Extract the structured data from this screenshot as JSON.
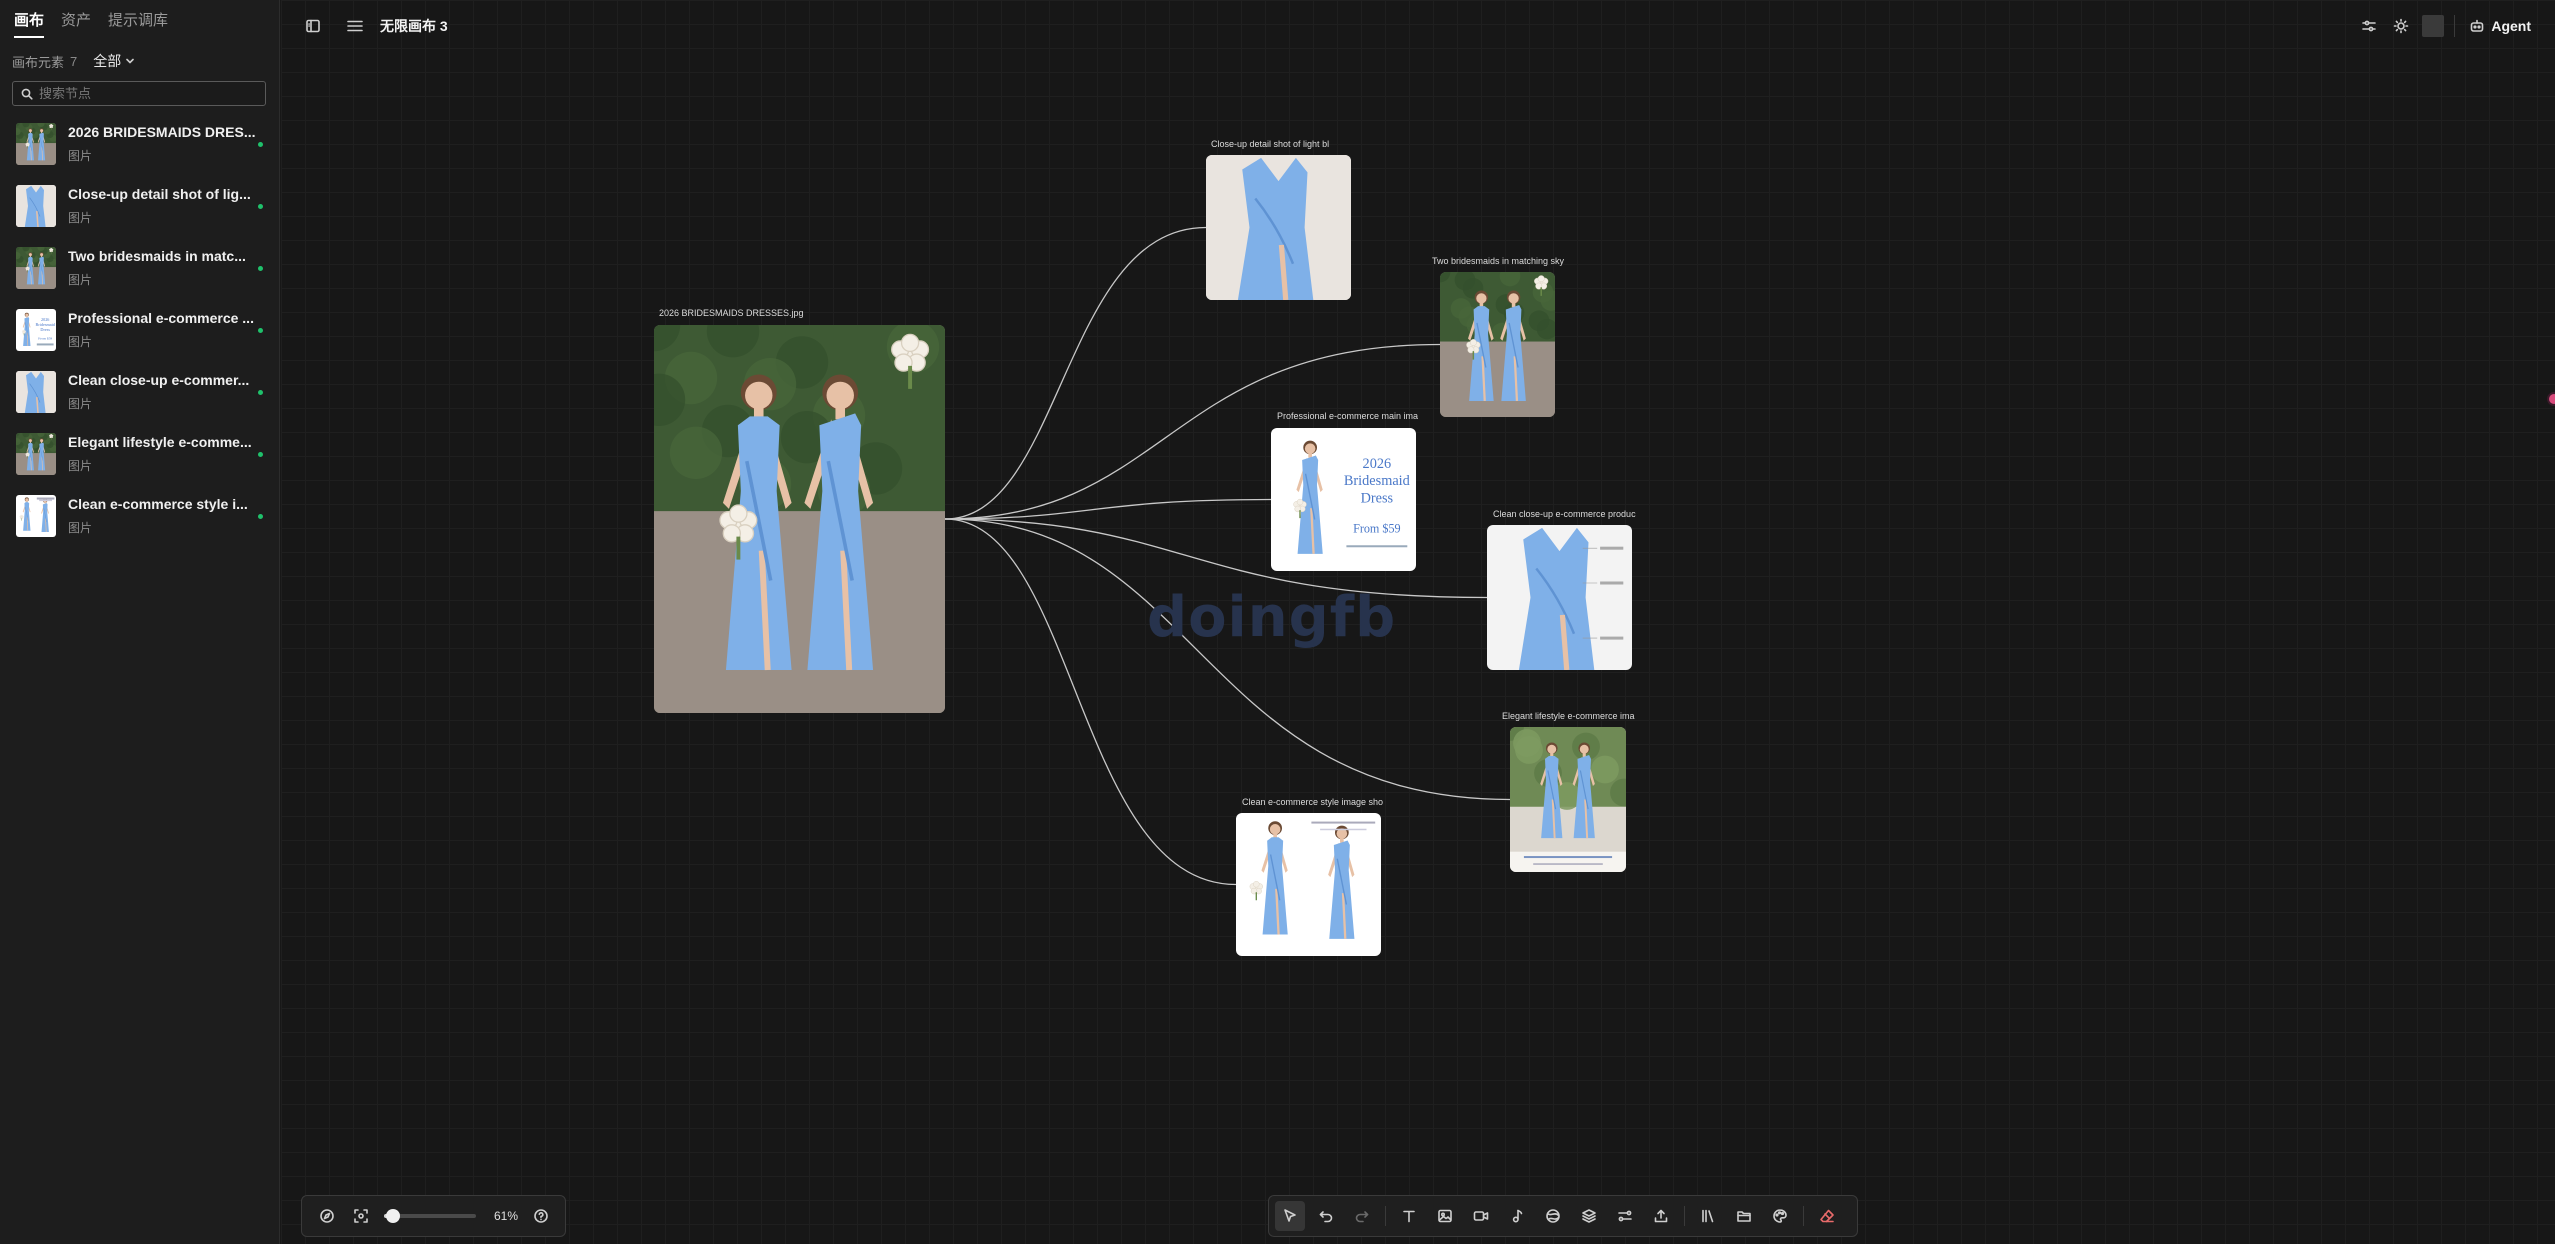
{
  "sidebar": {
    "tabs": [
      {
        "label": "画布",
        "active": true
      },
      {
        "label": "资产",
        "active": false
      },
      {
        "label": "提示调库",
        "active": false
      }
    ],
    "filter": {
      "label": "画布元素",
      "count": "7",
      "selected": "全部"
    },
    "search": {
      "placeholder": "搜索节点"
    },
    "items": [
      {
        "title": "2026 BRIDESMAIDS DRES...",
        "type": "图片",
        "thumb": "photo-two-bridesmaids"
      },
      {
        "title": "Close-up detail shot of lig...",
        "type": "图片",
        "thumb": "dress-closeup"
      },
      {
        "title": "Two bridesmaids in matc...",
        "type": "图片",
        "thumb": "photo-two-bridesmaids"
      },
      {
        "title": "Professional e-commerce ...",
        "type": "图片",
        "thumb": "dress-ad"
      },
      {
        "title": "Clean close-up e-commer...",
        "type": "图片",
        "thumb": "dress-closeup"
      },
      {
        "title": "Elegant lifestyle e-comme...",
        "type": "图片",
        "thumb": "photo-two-bridesmaids"
      },
      {
        "title": "Clean e-commerce style i...",
        "type": "图片",
        "thumb": "dress-pair"
      }
    ],
    "status_color": "#1fc16b"
  },
  "topbar": {
    "title": "无限画布 3",
    "agent_label": "Agent",
    "icons": [
      "sidebar-toggle-icon",
      "menu-icon",
      "settings-sliders-icon",
      "sun-icon",
      "color-swatch",
      "robot-icon"
    ]
  },
  "canvas": {
    "watermark": "doingfb",
    "nodes": [
      {
        "label": "2026 BRIDESMAIDS DRESSES.jpg",
        "kind": "photo"
      },
      {
        "label": "Close-up detail shot of light bl",
        "kind": "closeup"
      },
      {
        "label": "Two bridesmaids in matching sky",
        "kind": "photo"
      },
      {
        "label": "Professional e-commerce main ima",
        "kind": "ad",
        "ad_lines": [
          "2026",
          "Bridesmaid",
          "Dress",
          "From $59"
        ]
      },
      {
        "label": "Clean close-up e-commerce produc",
        "kind": "closeup-annotated"
      },
      {
        "label": "Elegant lifestyle e-commerce ima",
        "kind": "lifestyle"
      },
      {
        "label": "Clean e-commerce style image sho",
        "kind": "pair"
      }
    ],
    "dress_color": "#7fb0e8",
    "edge_color": "#c8c8c8"
  },
  "zoom": {
    "level": "61%",
    "fraction": 0.1
  },
  "toolbar": {
    "tools": [
      "select-tool",
      "undo",
      "redo",
      "text-tool",
      "image-tool",
      "video-tool",
      "audio-tool",
      "shape-tool",
      "layers-tool",
      "connect-tool",
      "upload-tool",
      "library-tool",
      "folder-tool",
      "palette-tool",
      "eraser-tool"
    ]
  }
}
